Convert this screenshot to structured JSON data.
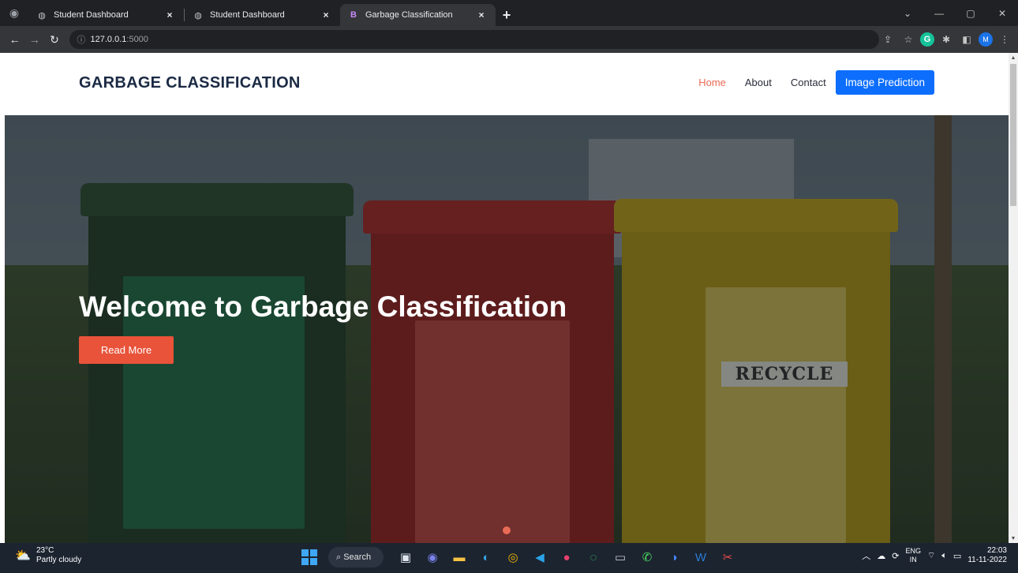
{
  "browser": {
    "tabs": [
      {
        "title": "Student Dashboard",
        "favicon": "globe-icon",
        "active": false
      },
      {
        "title": "Student Dashboard",
        "favicon": "globe-icon",
        "active": false
      },
      {
        "title": "Garbage Classification",
        "favicon": "bootstrap-icon",
        "favicon_glyph": "B",
        "active": true
      }
    ],
    "tab_close": "×",
    "new_tab": "+",
    "url_host": "127.0.0.1",
    "url_port": ":5000",
    "profile_initial": "M",
    "grammarly_initial": "G"
  },
  "site": {
    "brand": "GARBAGE CLASSIFICATION",
    "nav": [
      {
        "label": "Home",
        "active": true
      },
      {
        "label": "About",
        "active": false
      },
      {
        "label": "Contact",
        "active": false
      }
    ],
    "cta_label": "Image Prediction",
    "hero": {
      "title": "Welcome to Garbage Classification",
      "button_label": "Read More",
      "bin_label": "RECYCLE"
    },
    "accent_color": "#e96b56",
    "cta_color": "#0d6efd"
  },
  "taskbar": {
    "temperature": "23°C",
    "weather": "Partly cloudy",
    "search_label": "Search",
    "lang_line1": "ENG",
    "lang_line2": "IN",
    "time": "22:03",
    "date": "11-11-2022"
  }
}
